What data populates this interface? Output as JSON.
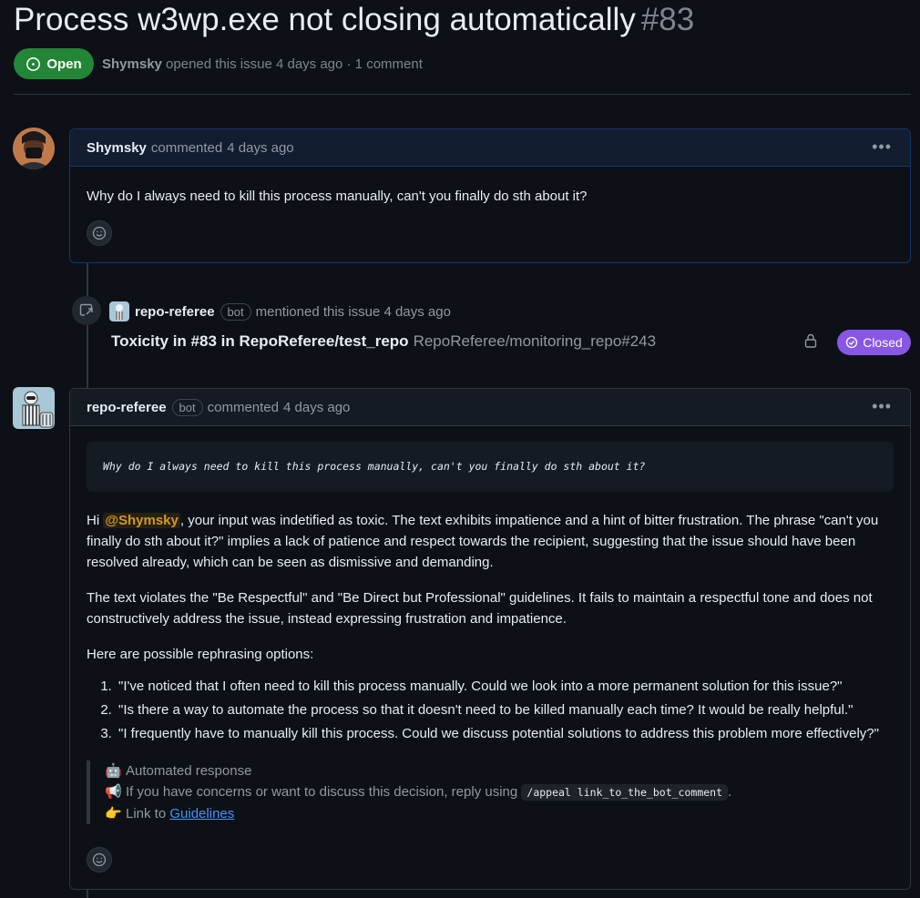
{
  "issue": {
    "title": "Process w3wp.exe not closing automatically",
    "number": "#83",
    "state": "Open",
    "author": "Shymsky",
    "meta_rest": "opened this issue 4 days ago · 1 comment"
  },
  "comment1": {
    "author": "Shymsky",
    "action": "commented",
    "time": "4 days ago",
    "body": "Why do I always need to kill this process manually, can't you finally do sth about it?"
  },
  "event": {
    "author": "repo-referee",
    "bot_label": "bot",
    "action": "mentioned this issue 4 days ago",
    "ref_title": "Toxicity in #83 in RepoReferee/test_repo",
    "ref_id": "RepoReferee/monitoring_repo#243",
    "ref_state": "Closed"
  },
  "comment2": {
    "author": "repo-referee",
    "bot_label": "bot",
    "action": "commented",
    "time": "4 days ago",
    "quote": "Why do I always need to kill this process manually, can't you finally do sth about it?",
    "p1_prefix": "Hi ",
    "p1_mention": "@Shymsky",
    "p1_rest": ", your input was indetified as toxic. The text exhibits impatience and a hint of bitter frustration. The phrase \"can't you finally do sth about it?\" implies a lack of patience and respect towards the recipient, suggesting that the issue should have been resolved already, which can be seen as dismissive and demanding.",
    "p2": "The text violates the \"Be Respectful\" and \"Be Direct but Professional\" guidelines. It fails to maintain a respectful tone and does not constructively address the issue, instead expressing frustration and impatience.",
    "p3": "Here are possible rephrasing options:",
    "options": [
      "\"I've noticed that I often need to kill this process manually. Could we look into a more permanent solution for this issue?\"",
      "\"Is there a way to automate the process so that it doesn't need to be killed manually each time? It would be really helpful.\"",
      "\"I frequently have to manually kill this process. Could we discuss potential solutions to address this problem more effectively?\""
    ],
    "footer_automated": "Automated response",
    "footer_concerns": "If you have concerns or want to discuss this decision, reply using",
    "footer_code": "/appeal link_to_the_bot_comment",
    "footer_code_end": ".",
    "footer_link_prefix": "Link to",
    "footer_link": "Guidelines"
  },
  "icons": [
    "issue-open-icon",
    "kebab-icon",
    "smiley-icon",
    "cross-reference-icon",
    "lock-icon",
    "closed-check-icon",
    "robot-emoji-icon",
    "megaphone-emoji-icon",
    "pointing-hand-emoji-icon"
  ],
  "colors": {
    "open": "#238636",
    "closed": "#8957e5",
    "link": "#4493f8",
    "mention": "#d29922",
    "bg": "#0d1117"
  }
}
